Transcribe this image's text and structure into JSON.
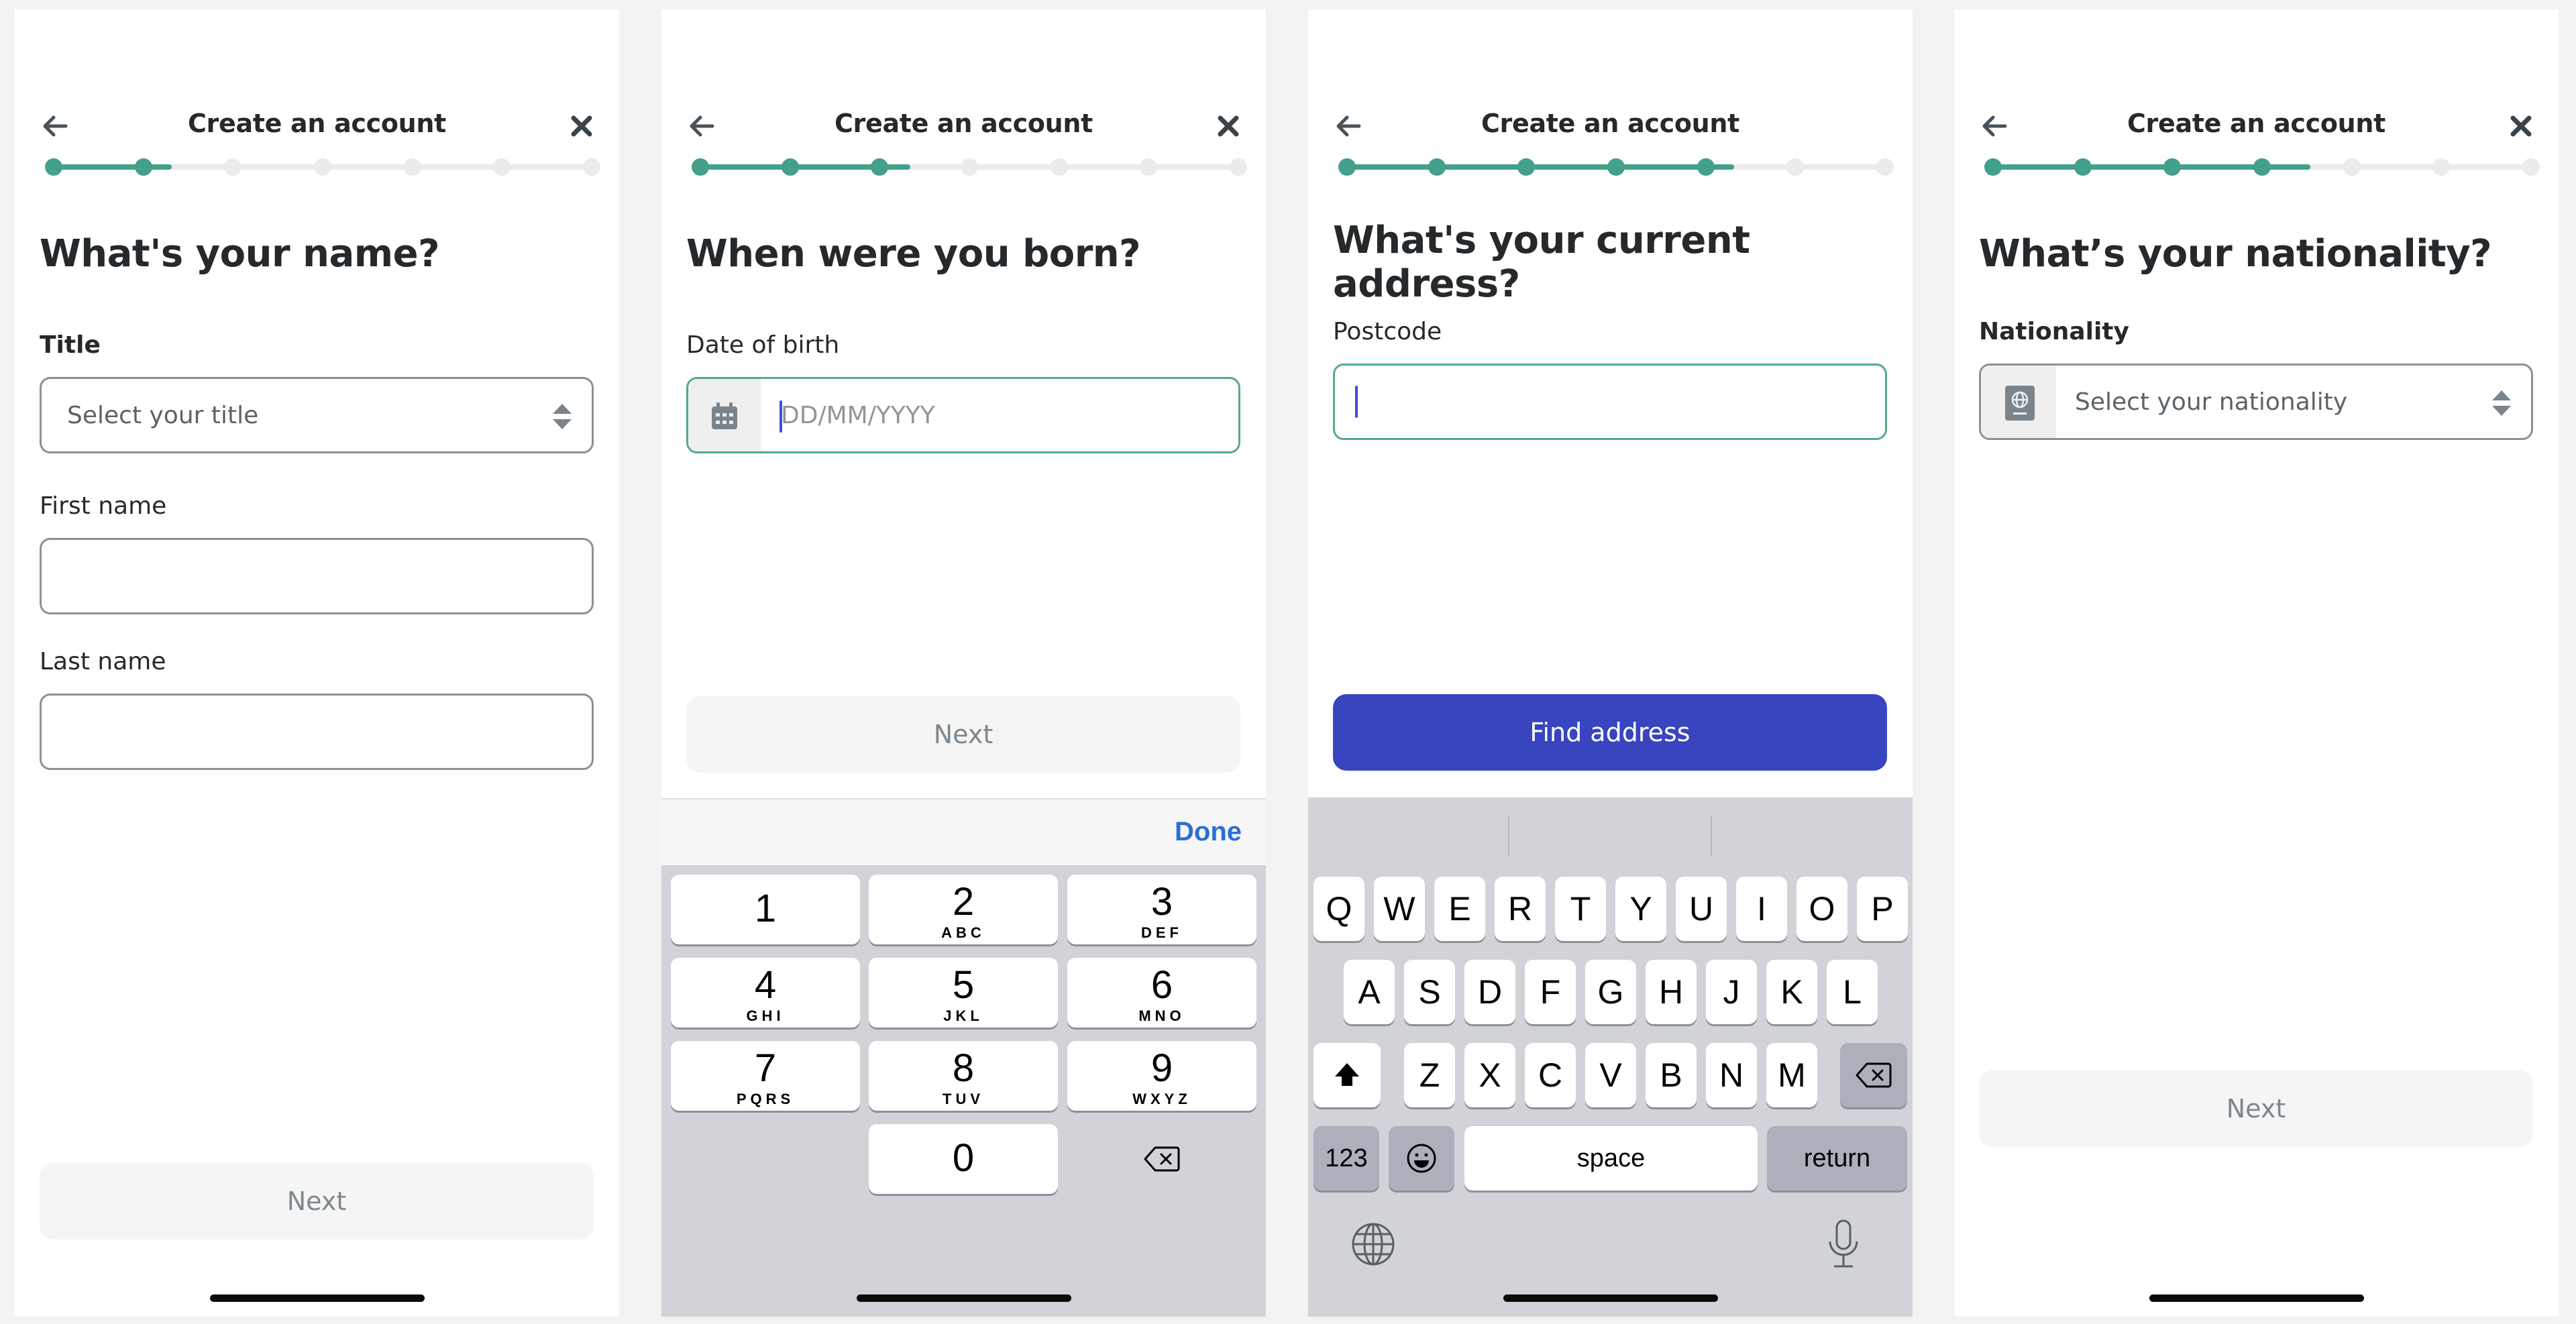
{
  "brand_colors": {
    "progress_active": "#43a08a",
    "progress_inactive": "#ebebeb",
    "focus_border": "#52a895",
    "primary_button": "#3845bf",
    "done_link": "#2a6fd6"
  },
  "screens": [
    {
      "header": {
        "title": "Create an account",
        "back_icon": "arrow-left-icon",
        "close_icon": "close-icon"
      },
      "progress": {
        "total_steps": 7,
        "completed_steps": 2,
        "fill_fraction": 0.22
      },
      "heading": "What's your name?",
      "fields": [
        {
          "label": "Title",
          "type": "select",
          "placeholder": "Select your title",
          "icon": "stepper-chevrons-icon"
        },
        {
          "label": "First name",
          "type": "text",
          "value": ""
        },
        {
          "label": "Last name",
          "type": "text",
          "value": ""
        }
      ],
      "next_button": {
        "label": "Next",
        "state": "disabled"
      }
    },
    {
      "header": {
        "title": "Create an account",
        "back_icon": "arrow-left-icon",
        "close_icon": "close-icon"
      },
      "progress": {
        "total_steps": 7,
        "completed_steps": 3,
        "fill_fraction": 0.39
      },
      "heading": "When were you born?",
      "fields": [
        {
          "label": "Date of birth",
          "type": "date",
          "placeholder": "DD/MM/YYYY",
          "icon": "calendar-icon",
          "focused": true
        }
      ],
      "next_button": {
        "label": "Next",
        "state": "disabled"
      },
      "keyboard": {
        "toolbar_done": "Done",
        "keys": [
          {
            "digit": "1",
            "letters": ""
          },
          {
            "digit": "2",
            "letters": "ABC"
          },
          {
            "digit": "3",
            "letters": "DEF"
          },
          {
            "digit": "4",
            "letters": "GHI"
          },
          {
            "digit": "5",
            "letters": "JKL"
          },
          {
            "digit": "6",
            "letters": "MNO"
          },
          {
            "digit": "7",
            "letters": "PQRS"
          },
          {
            "digit": "8",
            "letters": "TUV"
          },
          {
            "digit": "9",
            "letters": "WXYZ"
          },
          {
            "digit": "0",
            "letters": ""
          }
        ],
        "delete_icon": "backspace-icon"
      }
    },
    {
      "header": {
        "title": "Create an account",
        "back_icon": "arrow-left-icon"
      },
      "progress": {
        "total_steps": 7,
        "completed_steps": 5,
        "fill_fraction": 0.72
      },
      "heading": "What's your current address?",
      "fields": [
        {
          "label": "Postcode",
          "type": "text",
          "value": "",
          "focused": true
        }
      ],
      "find_button": {
        "label": "Find address",
        "state": "enabled"
      },
      "keyboard": {
        "row1": [
          "Q",
          "W",
          "E",
          "R",
          "T",
          "Y",
          "U",
          "I",
          "O",
          "P"
        ],
        "row2": [
          "A",
          "S",
          "D",
          "F",
          "G",
          "H",
          "J",
          "K",
          "L"
        ],
        "row3": [
          "Z",
          "X",
          "C",
          "V",
          "B",
          "N",
          "M"
        ],
        "numbers_key": "123",
        "space_key": "space",
        "return_key": "return",
        "shift_icon": "shift-icon",
        "delete_icon": "backspace-icon",
        "emoji_icon": "emoji-icon",
        "globe_icon": "globe-icon",
        "mic_icon": "microphone-icon"
      }
    },
    {
      "header": {
        "title": "Create an account",
        "back_icon": "arrow-left-icon",
        "close_icon": "close-icon"
      },
      "progress": {
        "total_steps": 7,
        "completed_steps": 4,
        "fill_fraction": 0.59
      },
      "heading": "What’s your nationality?",
      "fields": [
        {
          "label": "Nationality",
          "type": "select",
          "placeholder": "Select your nationality",
          "icon": "passport-icon"
        }
      ],
      "next_button": {
        "label": "Next",
        "state": "disabled"
      }
    }
  ]
}
